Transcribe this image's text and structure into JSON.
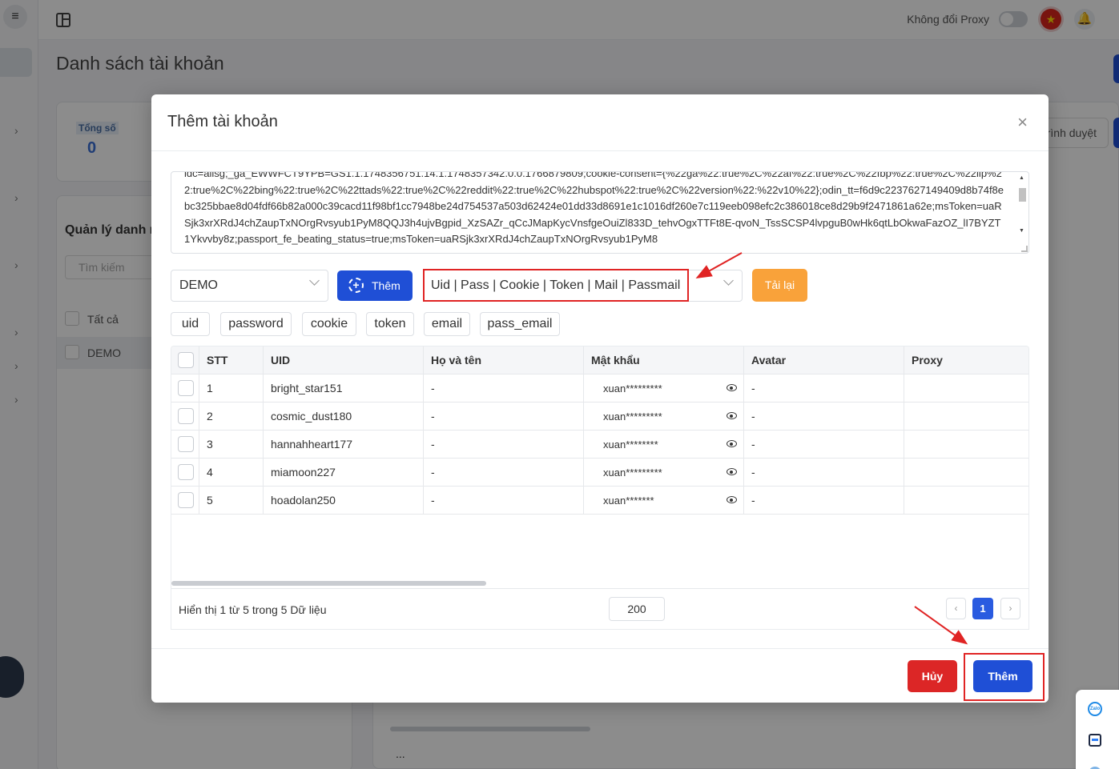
{
  "topbar": {
    "proxy_label": "Không đổi Proxy",
    "flag_glyph": "★"
  },
  "page": {
    "title": "Danh sách tài khoản",
    "total_label": "Tổng số",
    "total_value": "0",
    "manage_title": "Quản lý danh m",
    "search_placeholder": "Tìm kiếm",
    "list_all": "Tất cả",
    "list_demo": "DEMO",
    "browser_btn": "rình duyệt",
    "ellipsis": "..."
  },
  "modal": {
    "title": "Thêm tài khoản",
    "close_glyph": "×",
    "cookie_text": "ldc=allsg;_ga_EWWFCT9YPB=GS1.1.1748356751.14.1.1748357342.0.0.1766879809;cookie-consent={%22ga%22:true%2C%22af%22:true%2C%22fbp%22:true%2C%22lip%22:true%2C%22bing%22:true%2C%22ttads%22:true%2C%22reddit%22:true%2C%22hubspot%22:true%2C%22version%22:%22v10%22};odin_tt=f6d9c2237627149409d8b74f8ebc325bbae8d04fdf66b82a000c39cacd11f98bf1cc7948be24d754537a503d62424e01dd33d8691e1c1016df260e7c119eeb098efc2c386018ce8d29b9f2471861a62e;msToken=uaRSjk3xrXRdJ4chZaupTxNOrgRvsyub1PyM8QQJ3h4ujvBgpid_XzSAZr_qCcJMapKycVnsfgeOuiZl833D_tehvOgxTTFt8E-qvoN_TssSCSP4lvpguB0wHk6qtLbOkwaFazOZ_lI7BYZT1Ykvvby8z;passport_fe_beating_status=true;msToken=uaRSjk3xrXRdJ4chZaupTxNOrgRvsyub1PyM8",
    "group_select": "DEMO",
    "add_group_label": "Thêm",
    "format_select": "Uid | Pass | Cookie | Token | Mail | Passmail",
    "reload_label": "Tải lại",
    "field_tags": [
      "uid",
      "password",
      "cookie",
      "token",
      "email",
      "pass_email"
    ],
    "table": {
      "headers": [
        "STT",
        "UID",
        "Họ và tên",
        "Mật khẩu",
        "Avatar",
        "Proxy"
      ],
      "rows": [
        {
          "stt": "1",
          "uid": "bright_star151",
          "name": "-",
          "password": "xuan*********",
          "avatar": "-",
          "proxy": ""
        },
        {
          "stt": "2",
          "uid": "cosmic_dust180",
          "name": "-",
          "password": "xuan*********",
          "avatar": "-",
          "proxy": ""
        },
        {
          "stt": "3",
          "uid": "hannahheart177",
          "name": "-",
          "password": "xuan********",
          "avatar": "-",
          "proxy": ""
        },
        {
          "stt": "4",
          "uid": "miamoon227",
          "name": "-",
          "password": "xuan*********",
          "avatar": "-",
          "proxy": ""
        },
        {
          "stt": "5",
          "uid": "hoadolan250",
          "name": "-",
          "password": "xuan*******",
          "avatar": "-",
          "proxy": ""
        }
      ]
    },
    "footer": {
      "info": "Hiển thị 1 từ 5 trong 5 Dữ liệu",
      "page_size": "200",
      "prev": "‹",
      "current_page": "1",
      "next": "›"
    },
    "cancel_label": "Hủy",
    "submit_label": "Thêm"
  },
  "colors": {
    "primary": "#1f4fd6",
    "danger": "#dc2626",
    "warning": "#f9a23a",
    "annotation": "#e02424"
  },
  "side_widget": {
    "zalo_text": "Zalo"
  }
}
